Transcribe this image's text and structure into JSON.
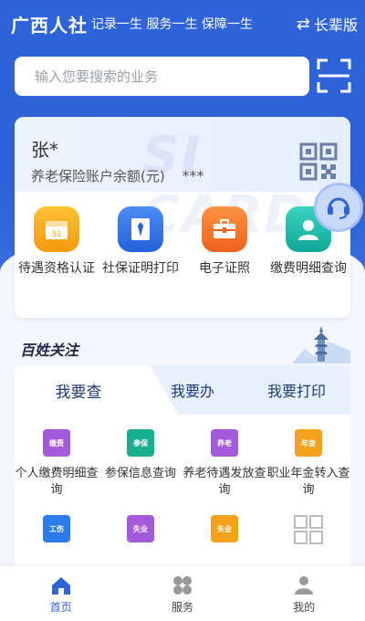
{
  "header": {
    "brand": "广西人社",
    "slogan": "记录一生 服务一生 保障一生",
    "elder_mode_label": "长辈版"
  },
  "search": {
    "placeholder": "输入您要搜索的业务"
  },
  "account": {
    "name": "张*",
    "balance_label": "养老保险账户余额(元)",
    "balance_value": "***",
    "card_watermark": "SI CARD"
  },
  "quick_services": [
    {
      "label": "待遇资格认证",
      "icon": "calendar-icon",
      "color": "#f6a21a"
    },
    {
      "label": "社保证明打印",
      "icon": "tie-document-icon",
      "color": "#2f6fe0"
    },
    {
      "label": "电子证照",
      "icon": "briefcase-icon",
      "color": "#f3702a"
    },
    {
      "label": "缴费明细查询",
      "icon": "person-icon",
      "color": "#19b7a7"
    }
  ],
  "section": {
    "title": "百姓关注"
  },
  "tabs": [
    {
      "label": "我要查",
      "active": true
    },
    {
      "label": "我要办",
      "active": false
    },
    {
      "label": "我要打印",
      "active": false
    }
  ],
  "grid_items": [
    {
      "label": "个人缴费明细查询",
      "tag": "缴费",
      "color": "#a35bd9",
      "icon": "payment-detail-icon"
    },
    {
      "label": "参保信息查询",
      "tag": "参保",
      "color": "#19b08f",
      "icon": "insurance-search-icon"
    },
    {
      "label": "养老待遇发放查询",
      "tag": "养老",
      "color": "#a35bd9",
      "icon": "pension-search-icon"
    },
    {
      "label": "职业年金转入查询",
      "tag": "年金",
      "color": "#f2a21b",
      "icon": "annuity-transfer-icon"
    },
    {
      "label": "",
      "tag": "工伤",
      "color": "#2d7be8",
      "icon": "injury-icon"
    },
    {
      "label": "",
      "tag": "失业",
      "color": "#a35bd9",
      "icon": "unemployment-icon"
    },
    {
      "label": "",
      "tag": "失业",
      "color": "#f2a21b",
      "icon": "unemployment-search-icon"
    },
    {
      "label": "",
      "tag": "",
      "color": "#bbbbbb",
      "icon": "more-grid-icon"
    }
  ],
  "bottom_nav": [
    {
      "label": "首页",
      "icon": "home-icon",
      "active": true
    },
    {
      "label": "服务",
      "icon": "service-icon",
      "active": false
    },
    {
      "label": "我的",
      "icon": "profile-icon",
      "active": false
    }
  ],
  "colors": {
    "primary": "#2f63d8",
    "background": "#f3f6fb"
  }
}
